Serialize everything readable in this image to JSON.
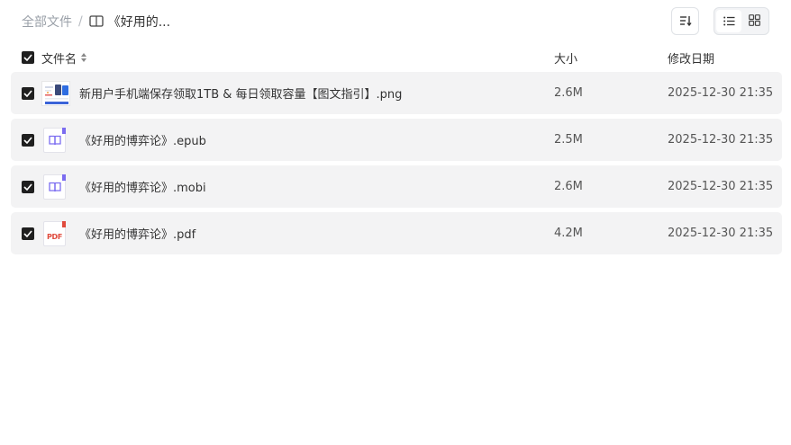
{
  "breadcrumb": {
    "root": "全部文件",
    "separator": "/",
    "current": "《好用的..."
  },
  "icons": {
    "sort": "sort-icon",
    "list_view": "list-view-icon",
    "grid_view": "grid-view-icon",
    "folder": "book-folder-icon",
    "epub": "book-icon",
    "mobi": "book-icon",
    "pdf": "pdf-icon",
    "png": "image-icon"
  },
  "colors": {
    "row_bg": "#f3f3f4",
    "checkbox": "#1f1f1f",
    "book_icon": "#7b6cf0",
    "pdf_red": "#e04a3c"
  },
  "header": {
    "name": "文件名",
    "size": "大小",
    "date": "修改日期"
  },
  "files": [
    {
      "type": "png",
      "name": "新用户手机端保存领取1TB & 每日领取容量【图文指引】.png",
      "size": "2.6M",
      "date": "2025-12-30 21:35",
      "checked": true
    },
    {
      "type": "epub",
      "name": "《好用的博弈论》.epub",
      "size": "2.5M",
      "date": "2025-12-30 21:35",
      "checked": true
    },
    {
      "type": "mobi",
      "name": "《好用的博弈论》.mobi",
      "size": "2.6M",
      "date": "2025-12-30 21:35",
      "checked": true
    },
    {
      "type": "pdf",
      "name": "《好用的博弈论》.pdf",
      "size": "4.2M",
      "date": "2025-12-30 21:35",
      "checked": true
    }
  ]
}
